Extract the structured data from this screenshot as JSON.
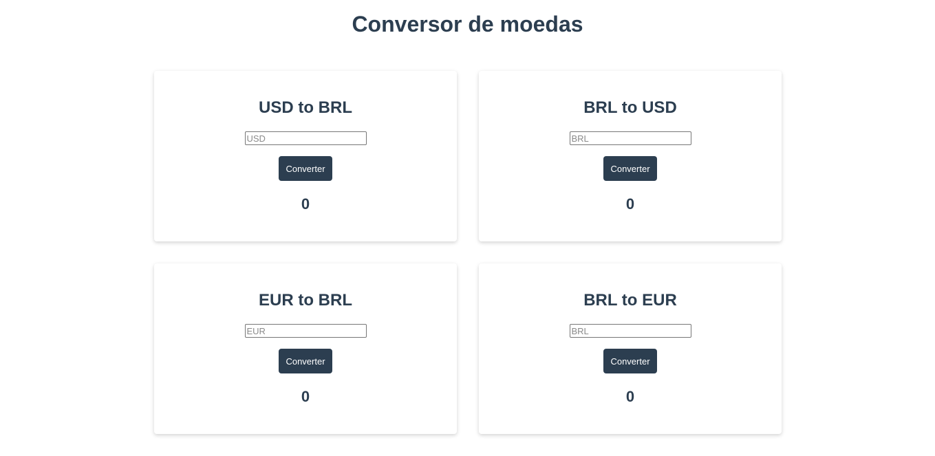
{
  "page": {
    "title": "Conversor de moedas"
  },
  "converters": [
    {
      "title": "USD to BRL",
      "placeholder": "USD",
      "button": "Converter",
      "result": "0"
    },
    {
      "title": "BRL to USD",
      "placeholder": "BRL",
      "button": "Converter",
      "result": "0"
    },
    {
      "title": "EUR to BRL",
      "placeholder": "EUR",
      "button": "Converter",
      "result": "0"
    },
    {
      "title": "BRL to EUR",
      "placeholder": "BRL",
      "button": "Converter",
      "result": "0"
    }
  ],
  "colors": {
    "primary": "#2c3e50",
    "button_text": "#ffffff",
    "background": "#ffffff"
  }
}
